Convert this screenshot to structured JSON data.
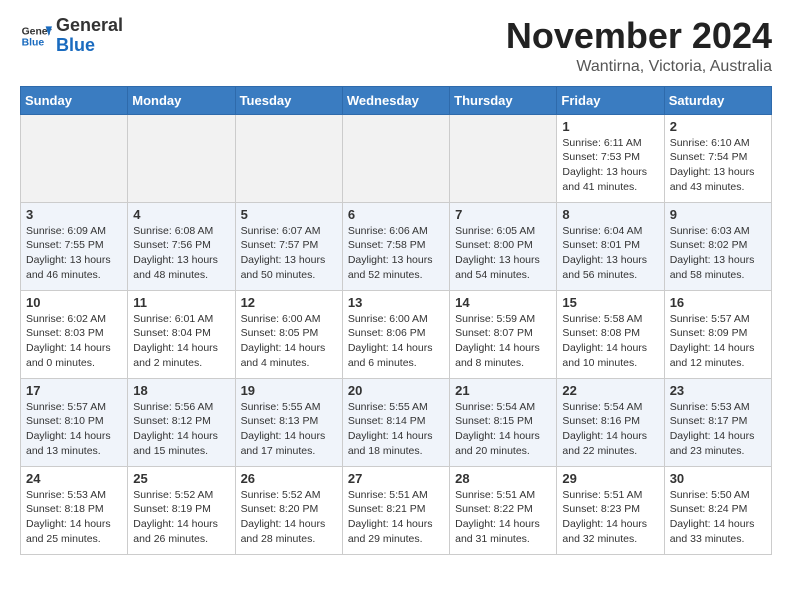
{
  "header": {
    "logo_general": "General",
    "logo_blue": "Blue",
    "month_title": "November 2024",
    "location": "Wantirna, Victoria, Australia"
  },
  "weekdays": [
    "Sunday",
    "Monday",
    "Tuesday",
    "Wednesday",
    "Thursday",
    "Friday",
    "Saturday"
  ],
  "weeks": [
    [
      {
        "day": "",
        "empty": true
      },
      {
        "day": "",
        "empty": true
      },
      {
        "day": "",
        "empty": true
      },
      {
        "day": "",
        "empty": true
      },
      {
        "day": "",
        "empty": true
      },
      {
        "day": "1",
        "sunrise": "6:11 AM",
        "sunset": "7:53 PM",
        "daylight": "13 hours and 41 minutes."
      },
      {
        "day": "2",
        "sunrise": "6:10 AM",
        "sunset": "7:54 PM",
        "daylight": "13 hours and 43 minutes."
      }
    ],
    [
      {
        "day": "3",
        "sunrise": "6:09 AM",
        "sunset": "7:55 PM",
        "daylight": "13 hours and 46 minutes."
      },
      {
        "day": "4",
        "sunrise": "6:08 AM",
        "sunset": "7:56 PM",
        "daylight": "13 hours and 48 minutes."
      },
      {
        "day": "5",
        "sunrise": "6:07 AM",
        "sunset": "7:57 PM",
        "daylight": "13 hours and 50 minutes."
      },
      {
        "day": "6",
        "sunrise": "6:06 AM",
        "sunset": "7:58 PM",
        "daylight": "13 hours and 52 minutes."
      },
      {
        "day": "7",
        "sunrise": "6:05 AM",
        "sunset": "8:00 PM",
        "daylight": "13 hours and 54 minutes."
      },
      {
        "day": "8",
        "sunrise": "6:04 AM",
        "sunset": "8:01 PM",
        "daylight": "13 hours and 56 minutes."
      },
      {
        "day": "9",
        "sunrise": "6:03 AM",
        "sunset": "8:02 PM",
        "daylight": "13 hours and 58 minutes."
      }
    ],
    [
      {
        "day": "10",
        "sunrise": "6:02 AM",
        "sunset": "8:03 PM",
        "daylight": "14 hours and 0 minutes."
      },
      {
        "day": "11",
        "sunrise": "6:01 AM",
        "sunset": "8:04 PM",
        "daylight": "14 hours and 2 minutes."
      },
      {
        "day": "12",
        "sunrise": "6:00 AM",
        "sunset": "8:05 PM",
        "daylight": "14 hours and 4 minutes."
      },
      {
        "day": "13",
        "sunrise": "6:00 AM",
        "sunset": "8:06 PM",
        "daylight": "14 hours and 6 minutes."
      },
      {
        "day": "14",
        "sunrise": "5:59 AM",
        "sunset": "8:07 PM",
        "daylight": "14 hours and 8 minutes."
      },
      {
        "day": "15",
        "sunrise": "5:58 AM",
        "sunset": "8:08 PM",
        "daylight": "14 hours and 10 minutes."
      },
      {
        "day": "16",
        "sunrise": "5:57 AM",
        "sunset": "8:09 PM",
        "daylight": "14 hours and 12 minutes."
      }
    ],
    [
      {
        "day": "17",
        "sunrise": "5:57 AM",
        "sunset": "8:10 PM",
        "daylight": "14 hours and 13 minutes."
      },
      {
        "day": "18",
        "sunrise": "5:56 AM",
        "sunset": "8:12 PM",
        "daylight": "14 hours and 15 minutes."
      },
      {
        "day": "19",
        "sunrise": "5:55 AM",
        "sunset": "8:13 PM",
        "daylight": "14 hours and 17 minutes."
      },
      {
        "day": "20",
        "sunrise": "5:55 AM",
        "sunset": "8:14 PM",
        "daylight": "14 hours and 18 minutes."
      },
      {
        "day": "21",
        "sunrise": "5:54 AM",
        "sunset": "8:15 PM",
        "daylight": "14 hours and 20 minutes."
      },
      {
        "day": "22",
        "sunrise": "5:54 AM",
        "sunset": "8:16 PM",
        "daylight": "14 hours and 22 minutes."
      },
      {
        "day": "23",
        "sunrise": "5:53 AM",
        "sunset": "8:17 PM",
        "daylight": "14 hours and 23 minutes."
      }
    ],
    [
      {
        "day": "24",
        "sunrise": "5:53 AM",
        "sunset": "8:18 PM",
        "daylight": "14 hours and 25 minutes."
      },
      {
        "day": "25",
        "sunrise": "5:52 AM",
        "sunset": "8:19 PM",
        "daylight": "14 hours and 26 minutes."
      },
      {
        "day": "26",
        "sunrise": "5:52 AM",
        "sunset": "8:20 PM",
        "daylight": "14 hours and 28 minutes."
      },
      {
        "day": "27",
        "sunrise": "5:51 AM",
        "sunset": "8:21 PM",
        "daylight": "14 hours and 29 minutes."
      },
      {
        "day": "28",
        "sunrise": "5:51 AM",
        "sunset": "8:22 PM",
        "daylight": "14 hours and 31 minutes."
      },
      {
        "day": "29",
        "sunrise": "5:51 AM",
        "sunset": "8:23 PM",
        "daylight": "14 hours and 32 minutes."
      },
      {
        "day": "30",
        "sunrise": "5:50 AM",
        "sunset": "8:24 PM",
        "daylight": "14 hours and 33 minutes."
      }
    ]
  ]
}
